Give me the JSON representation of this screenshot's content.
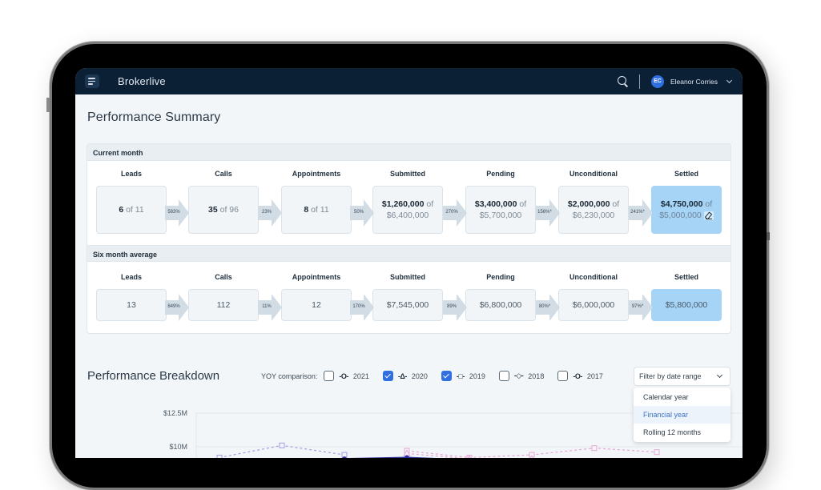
{
  "app": {
    "brand": "Brokerlive",
    "user_initials": "EC",
    "user_name": "Eleanor Corries"
  },
  "page_title": "Performance Summary",
  "current_month": {
    "heading": "Current month",
    "stages": [
      {
        "label": "Leads",
        "value": "6",
        "of": " of 11"
      },
      {
        "label": "Calls",
        "value": "35",
        "of": " of 96"
      },
      {
        "label": "Appointments",
        "value": "8",
        "of": " of 11"
      },
      {
        "label": "Submitted",
        "value": "$1,260,000",
        "of_inline": " of",
        "of": "$6,400,000"
      },
      {
        "label": "Pending",
        "value": "$3,400,000",
        "of_inline": " of",
        "of": "$5,700,000"
      },
      {
        "label": "Unconditional",
        "value": "$2,000,000",
        "of_inline": " of",
        "of": "$6,230,000"
      },
      {
        "label": "Settled",
        "value": "$4,750,000",
        "of_inline": " of",
        "of": "$5,000,000"
      }
    ],
    "conversions": [
      "583%",
      "23%",
      "50%",
      "270%",
      "156%*",
      "241%*"
    ]
  },
  "six_month_average": {
    "heading": "Six month average",
    "stages": [
      {
        "label": "Leads",
        "value": "13"
      },
      {
        "label": "Calls",
        "value": "112"
      },
      {
        "label": "Appointments",
        "value": "12"
      },
      {
        "label": "Submitted",
        "value": "$7,545,000"
      },
      {
        "label": "Pending",
        "value": "$6,800,000"
      },
      {
        "label": "Unconditional",
        "value": "$6,000,000"
      },
      {
        "label": "Settled",
        "value": "$5,800,000"
      }
    ],
    "conversions": [
      "849%",
      "11%",
      "170%",
      "89%",
      "80%*",
      "97%*"
    ]
  },
  "breakdown": {
    "title": "Performance Breakdown",
    "yoy_label": "YOY comparison:",
    "years": [
      {
        "year": "2021",
        "marker": "-O-",
        "checked": false
      },
      {
        "year": "2020",
        "marker": "-Δ-",
        "checked": true
      },
      {
        "year": "2019",
        "marker": "-□-",
        "checked": true
      },
      {
        "year": "2018",
        "marker": "-◇-",
        "checked": false
      },
      {
        "year": "2017",
        "marker": "-O-",
        "checked": false
      }
    ],
    "filter": {
      "label": "Filter by date range",
      "options": [
        "Calendar year",
        "Financial year",
        "Rolling 12 months"
      ],
      "highlighted": "Financial year"
    }
  },
  "chart_data": {
    "type": "line",
    "title": "",
    "xlabel": "",
    "ylabel": "",
    "y_ticks": [
      "$12.5M",
      "$10M"
    ],
    "ylim_visible": [
      9.0,
      12.5
    ],
    "grid": true,
    "series": [
      {
        "name": "2019",
        "style": "dashed",
        "marker": "square",
        "color": "#a79be3",
        "x_index": [
          0,
          1,
          2
        ],
        "values": [
          9.2,
          10.1,
          9.4
        ]
      },
      {
        "name": "2019-pink",
        "style": "dashed",
        "marker": "square",
        "color": "#e7a6d6",
        "x_index": [
          3,
          4,
          5,
          6,
          7
        ],
        "values": [
          9.7,
          9.2,
          9.4,
          9.9,
          9.6
        ]
      },
      {
        "name": "2020",
        "style": "dashed",
        "marker": "triangle",
        "color": "#e7a6d6",
        "x_index": [
          3,
          4,
          5
        ],
        "values": [
          9.5,
          9.1,
          9.1
        ]
      },
      {
        "name": "current",
        "style": "solid",
        "marker": "circle",
        "color": "#2b2f9e",
        "x_index": [
          2,
          3,
          4
        ],
        "values": [
          9.1,
          9.2,
          9.0
        ]
      }
    ]
  },
  "colors": {
    "topbar": "#0b1f35",
    "accent": "#2f6fe0",
    "settled_bg": "#a5d4f7",
    "arrow": "#d1dce5"
  }
}
